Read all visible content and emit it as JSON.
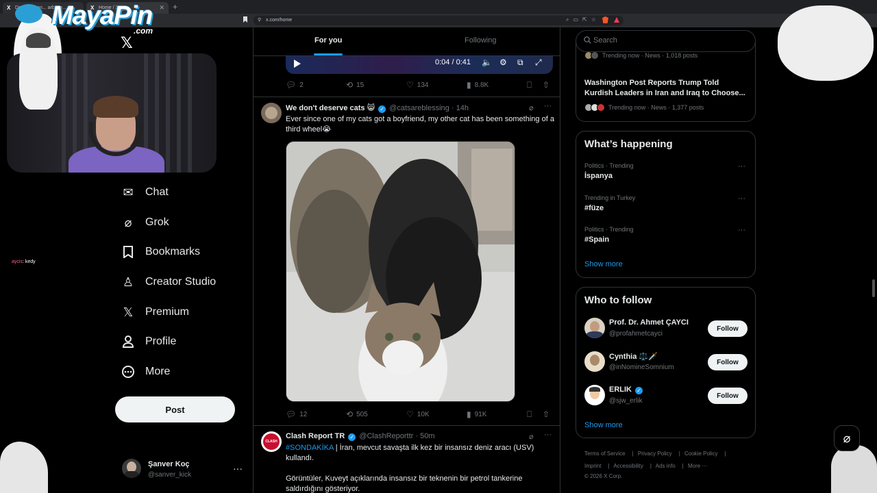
{
  "browser": {
    "tabs": [
      {
        "label": "Da... X: \"Iran... arbaye..."
      },
      {
        "label": "Home / X"
      }
    ],
    "url": "x.com/home"
  },
  "overlay": {
    "brand_main": "MayaPin",
    "brand_suffix": ".com",
    "chat_user": "aycis",
    "chat_message": ": kedy"
  },
  "sidebar": {
    "items": [
      {
        "label": "Chat",
        "icon": "mail-icon"
      },
      {
        "label": "Grok",
        "icon": "grok-icon"
      },
      {
        "label": "Bookmarks",
        "icon": "bookmark-icon"
      },
      {
        "label": "Creator Studio",
        "icon": "creator-studio-icon"
      },
      {
        "label": "Premium",
        "icon": "x-premium-icon"
      },
      {
        "label": "Profile",
        "icon": "person-icon"
      },
      {
        "label": "More",
        "icon": "more-circle-icon"
      }
    ],
    "post_label": "Post",
    "account": {
      "name": "Şanver Koç",
      "handle": "@sanver_kick"
    }
  },
  "feed": {
    "tabs": {
      "for_you": "For you",
      "following": "Following"
    },
    "video_player": {
      "time": "0:04 / 0:41"
    },
    "tweet0_actions": {
      "replies": "2",
      "reposts": "15",
      "likes": "134",
      "views": "8.8K"
    },
    "tweet1": {
      "name": "We don't deserve cats 😸",
      "handle": "@catsareblessing",
      "time": "14h",
      "text": "Ever since one of my cats got a boyfriend, my other cat has been something of a third wheel😭",
      "actions": {
        "replies": "12",
        "reposts": "505",
        "likes": "10K",
        "views": "91K"
      }
    },
    "tweet2": {
      "name": "Clash Report TR",
      "handle": "@ClashReporttr",
      "time": "50m",
      "hashtag": "#SONDAKİKA",
      "text1": " | İran, mevcut savaşta ilk kez bir insansız deniz aracı (USV) kullandı.",
      "text2": "Görüntüler, Kuveyt açıklarında insansız bir teknenin bir petrol tankerine saldırdığını gösteriyor."
    }
  },
  "right": {
    "search_placeholder": "Search",
    "news_top_meta": "Trending now · News · 1,018 posts",
    "news": {
      "title": "Washington Post Reports Trump Told Kurdish Leaders in Iran and Iraq to Choose...",
      "meta": "Trending now · News · 1,377 posts"
    },
    "whats_happening": {
      "title": "What’s happening",
      "trends": [
        {
          "meta": "Politics · Trending",
          "name": "İspanya"
        },
        {
          "meta": "Trending in Turkey",
          "name": "#füze"
        },
        {
          "meta": "Politics · Trending",
          "name": "#Spain"
        }
      ],
      "show_more": "Show more"
    },
    "who_to_follow": {
      "title": "Who to follow",
      "users": [
        {
          "name": "Prof. Dr. Ahmet ÇAYCI",
          "handle": "@profahmetcayci",
          "button": "Follow"
        },
        {
          "name": "Cynthia ⚖️🗡️",
          "handle": "@inNomineSomnium",
          "button": "Follow"
        },
        {
          "name": "ERLIK",
          "handle": "@sjw_erlik",
          "button": "Follow"
        }
      ],
      "show_more": "Show more"
    },
    "footer": {
      "row1": [
        "Terms of Service",
        "Privacy Policy",
        "Cookie Policy"
      ],
      "row2": [
        "Imprint",
        "Accessibility",
        "Ads info",
        "More ···"
      ],
      "copyright": "© 2026 X Corp."
    }
  }
}
